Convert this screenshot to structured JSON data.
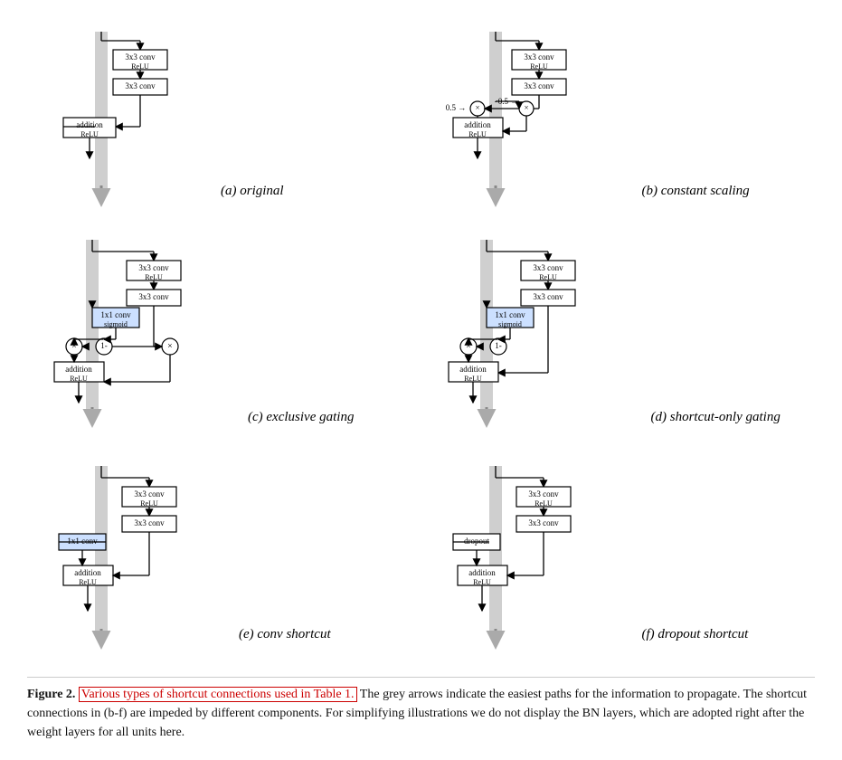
{
  "figure": {
    "title": "Figure 2.",
    "caption_link": "Various types of shortcut connections used in Table 1.",
    "caption_text": " The grey arrows indicate the easiest paths for the information to propagate. The shortcut connections in (b-f) are impeded by different components. For simplifying illustrations we do not display the BN layers, which are adopted right after the weight layers for all units here.",
    "diagrams": [
      {
        "id": "a",
        "label": "(a) original"
      },
      {
        "id": "b",
        "label": "(b) constant scaling"
      },
      {
        "id": "c",
        "label": "(c) exclusive gating"
      },
      {
        "id": "d",
        "label": "(d) shortcut-only gating"
      },
      {
        "id": "e",
        "label": "(e) conv shortcut"
      },
      {
        "id": "f",
        "label": "(f) dropout shortcut"
      }
    ]
  }
}
